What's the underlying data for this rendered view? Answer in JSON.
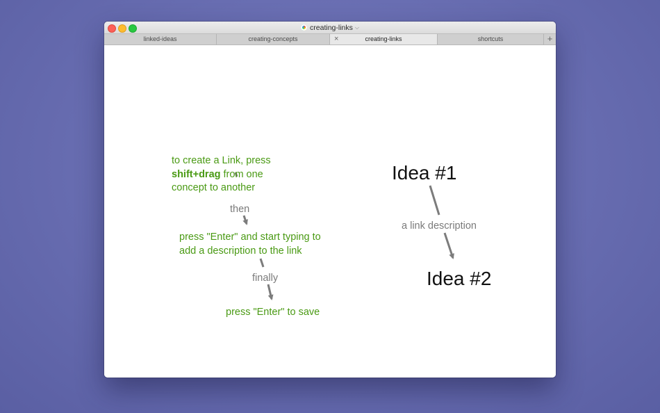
{
  "window": {
    "title": "creating-links",
    "icons": {
      "document": "document-icon",
      "title_menu": "chevron-down-icon",
      "tab_close": "close-icon",
      "tab_add": "plus-icon"
    }
  },
  "tabs": [
    {
      "label": "linked-ideas",
      "active": false
    },
    {
      "label": "creating-concepts",
      "active": false
    },
    {
      "label": "creating-links",
      "active": true
    },
    {
      "label": "shortcuts",
      "active": false
    }
  ],
  "canvas": {
    "concept1": {
      "part1": "to create a Link, press",
      "bold": "shift+drag",
      "part2": " from one",
      "part3": "concept to another"
    },
    "link1_label": "then",
    "concept2": {
      "line1": "press \"Enter\" and start typing to",
      "line2": "add a description to the link"
    },
    "link2_label": "finally",
    "concept3": "press \"Enter\" to save",
    "idea1": "Idea #1",
    "idea_link_label": "a link description",
    "idea2": "Idea #2"
  },
  "colors": {
    "concept_text": "#4a9a14",
    "link_text": "#7a7a7a",
    "link_stroke": "#7c7c7c",
    "idea_text": "#111111",
    "desktop": "#6a6fb3"
  }
}
